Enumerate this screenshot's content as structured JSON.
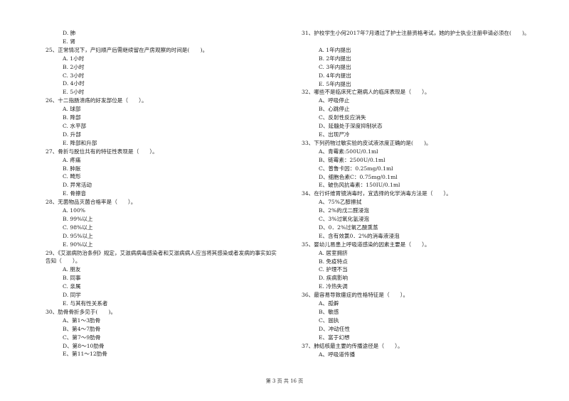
{
  "left_column": {
    "leading_options": [
      "D. 肺",
      "E. 肾"
    ],
    "questions": [
      {
        "stem": "25、正常情况下，产妇顺产后需继续留在产房观察的时间是(　　)。",
        "options": [
          "A. 1小时",
          "B. 2小时",
          "C. 3小时",
          "D. 4小时",
          "E. 5小时"
        ]
      },
      {
        "stem": "26、十二指肠溃疡的好发部位是（　　）。",
        "options": [
          "A. 球部",
          "B. 降部",
          "C. 水平部",
          "D. 升部",
          "E. 降部和升部"
        ]
      },
      {
        "stem": "27、骨折与脱位共有的特征性表现是（　　）。",
        "options": [
          "A. 疼痛",
          "B. 肿胀",
          "C. 畸形",
          "D. 异常活动",
          "E. 骨擦音"
        ]
      },
      {
        "stem": "28、无菌物品灭菌合格率是（　　）。",
        "options": [
          "A. 100%",
          "B. 99%以上",
          "C. 98%以上",
          "D. 95%以上",
          "E. 90%以上"
        ]
      },
      {
        "stem": "29、《艾滋病防治条例》规定，艾滋病病毒感染者和艾滋病病人应当将其感染或者发病的事实如实告知（　　）。",
        "options": [
          "A. 朋友",
          "B. 同事",
          "C. 亲属",
          "D. 同学",
          "E. 与其有性关系者"
        ]
      },
      {
        "stem": "30、肋骨骨折多见于(　　)。",
        "options": [
          "A、第1～3肋骨",
          "B、第4～7肋骨",
          "C、第7～9肋骨",
          "D、第8～10肋骨",
          "E、第11～12肋骨"
        ]
      }
    ]
  },
  "right_column": {
    "questions": [
      {
        "stem": "31、护校学生小何2017年7月通过了护士注册资格考试，她的护士执业注册申请必须在(　　)。",
        "options": [
          "A. 1年内提出",
          "B. 2年内提出",
          "C. 3年内提出",
          "D. 4年内提出",
          "E. 5年内提出"
        ]
      },
      {
        "stem": "32、哪些不是临床死亡期病人的临床表现是（　　）。",
        "options": [
          "A、呼吸停止",
          "B、心跳停止",
          "C、反射性反应消失",
          "D、延髓处于深度抑制状态",
          "E、出现尸冷"
        ]
      },
      {
        "stem": "33、下列药物过敏实验的皮试液浓度正确的是(　　)。",
        "options": [
          "A、青霉素:500U/0.1ml",
          "B、链霉素：2500U/0.1ml",
          "C、普鲁卡因：0.25mg/0.1ml",
          "D、细胞色素C：0.75mg/0.1ml",
          "E、破伤风抗毒素：150IU/0.1ml"
        ]
      },
      {
        "stem": "34、在行纤维胃镜消毒时，宜选择的化学消毒方法是（　　）。",
        "options": [
          "A、75%乙醇擦拭",
          "B、2%的戊二醛浸泡",
          "C、3%过氧化氢浸泡",
          "D、0．2%过氧乙酸熏蒸",
          "E、含有效氯0．2%的消毒液浸泡"
        ]
      },
      {
        "stem": "35、婴幼儿易患上呼吸道感染的因素主要是（　　）。",
        "options": [
          "A. 居室拥挤",
          "B. 免疫特点",
          "C. 护理不当",
          "D. 疾病影响",
          "E. 冷热失调"
        ]
      },
      {
        "stem": "36、最容易导致癔症的性格特征是（　　）。",
        "options": [
          "A、孤僻",
          "B、敏感",
          "C、固执",
          "D、冲动任性",
          "E、富于幻想"
        ]
      },
      {
        "stem": "37、肺结核最主要的传播途径是（　　）。",
        "options": [
          "A、呼吸道传播"
        ]
      }
    ]
  },
  "footer": {
    "page_label": "第 3 页 共 16 页"
  }
}
